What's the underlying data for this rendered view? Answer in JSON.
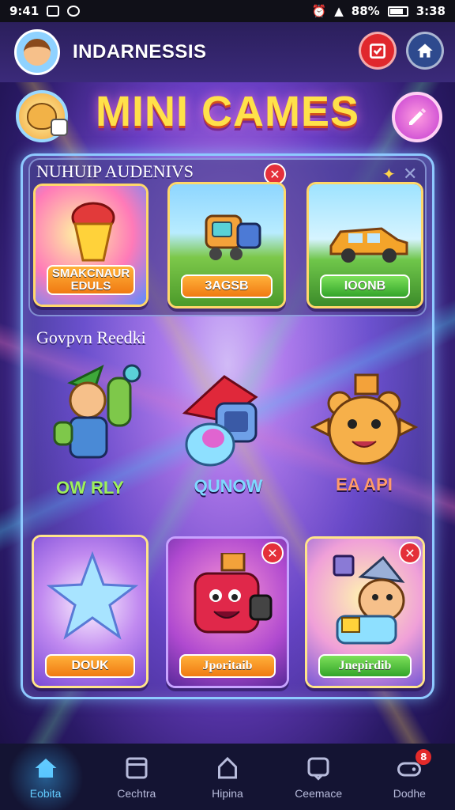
{
  "status_bar": {
    "time_left": "9:41",
    "battery": "88%",
    "time_right": "3:38"
  },
  "header": {
    "username": "INDARNESSIS"
  },
  "title": "MINI CAMES",
  "featured": {
    "section_title": "NUHUIP AUDENIVS",
    "cards": [
      {
        "label": "SMAKCNAUR EDULS",
        "theme": "lamp"
      },
      {
        "label": "3AGSB",
        "theme": "robot"
      },
      {
        "label": "IOONB",
        "theme": "car"
      }
    ]
  },
  "characters": {
    "section_title": "Govpvn Reedki",
    "items": [
      {
        "name": "OW RLY",
        "color": "#9df05a"
      },
      {
        "name": "QUNOW",
        "color": "#7fd8ff"
      },
      {
        "name": "EA API",
        "color": "#ff9a6a"
      }
    ]
  },
  "game_cards": [
    {
      "label": "DOUK",
      "style": "orange"
    },
    {
      "label": "Jporitaib",
      "style": "orange"
    },
    {
      "label": "Jnepirdib",
      "style": "green"
    }
  ],
  "bottom_nav": [
    {
      "label": "Eobita",
      "icon": "home-icon",
      "active": true
    },
    {
      "label": "Cechtra",
      "icon": "cards-icon",
      "active": false
    },
    {
      "label": "Hipina",
      "icon": "bag-icon",
      "active": false
    },
    {
      "label": "Ceemace",
      "icon": "chat-icon",
      "active": false
    },
    {
      "label": "Dodhe",
      "icon": "gamepad-icon",
      "active": false,
      "badge": "8"
    }
  ],
  "colors": {
    "accent": "#ffe14a",
    "panel_border": "#8ec9ff",
    "close": "#e4303a"
  }
}
